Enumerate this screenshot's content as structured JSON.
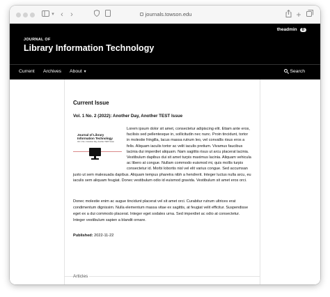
{
  "browser": {
    "url": "journals.towson.edu"
  },
  "header": {
    "user": "theadmin",
    "notification_count": "0",
    "journal_prefix": "JOURNAL OF",
    "journal_title": "Library Information Technology"
  },
  "nav": {
    "items": [
      "Current",
      "Archives",
      "About"
    ],
    "search": "Search"
  },
  "main": {
    "heading": "Current Issue",
    "issue_title": "Vol. 1 No. 2 (2022): Another Day, Another TEST Issue",
    "cover": {
      "title_line1": "Journal of Library",
      "title_line2": "Information Technology",
      "subtitle": "Vol. 1 No. 2 Another Day, Another TEST Issue"
    },
    "description": "Lorem ipsum dolor sit amet, consectetur adipiscing elit. Etiam ante eros, facilisis sed pellentesque in, sollicitudin nec nunc. Proin tincidunt, tortor in molestie fringilla, lacus massa rutrum leo, vel convallis risus eros a felis. Aliquam iaculis tortor ac velit iaculis pretium. Vivamus faucibus lacinia dui imperdiet aliquam. Nam sagittis risus ut arcu placerat lacinia. Vestibulum dapibus dui sit amet turpis maximus lacinia. Aliquam vehicula ac libero at congue. Nullam commodo euismod mi, quis mollis turpis consectetur id. Morbi lobortis nisl vel elit varius congue. Sed accumsan justo ut sem malesuada dapibus. Aliquam tempus pharetra nibh a hendrerit. Integer luctus nulla arcu, eu iaculis sem aliquam feugiat. Donec vestibulum odio id euismod gravida. Vestibulum sit amet eros orci.",
    "description2": "Donec molestie enim ac augue tincidunt placerat vel sit amet orci. Curabitur rutrum ultrices erat condimentum dignissim. Nulla elementum massa vitae ex sagittis, at feugiat velit efficitur. Suspendisse eget ex a dui commodo placerat. Integer eget sodales urna. Sed imperdiet ac odio at consectetur. Integer vestibulum sapien a blandit ornare.",
    "published_label": "Published:",
    "published_date": "2022-11-22",
    "articles_label": "Articles"
  }
}
